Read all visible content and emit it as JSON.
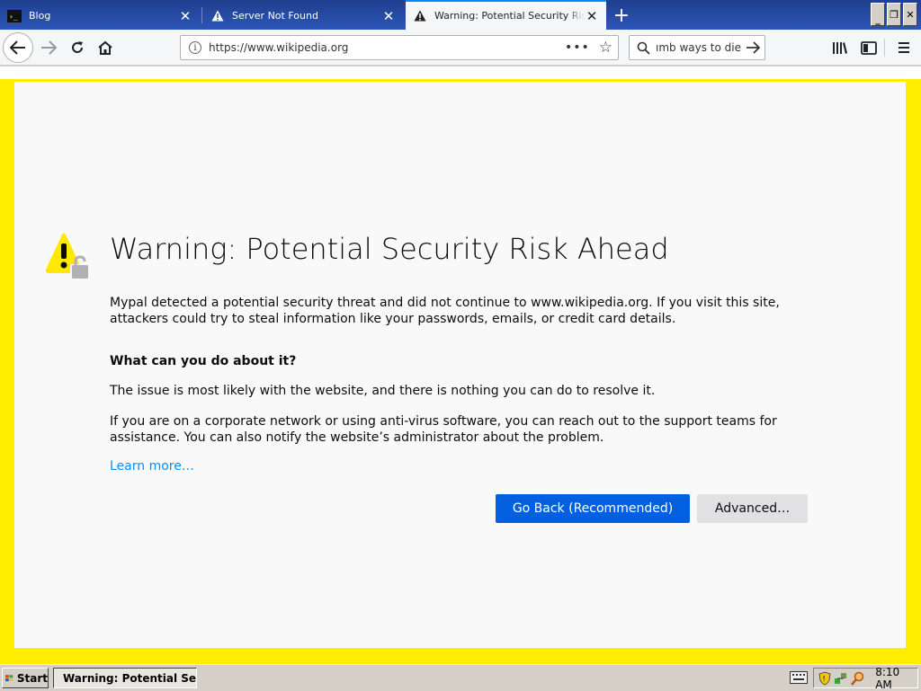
{
  "tabs": [
    {
      "label": "Blog",
      "icon": "terminal-icon"
    },
    {
      "label": "Server Not Found",
      "icon": "warning-icon"
    },
    {
      "label": "Warning: Potential Security Risk Ahead",
      "icon": "warning-icon",
      "active": true
    }
  ],
  "window_controls": {
    "minimize": "_",
    "restore": "❐",
    "close": "✕"
  },
  "nav": {
    "url": "https://www.wikipedia.org",
    "search_text": "ımb ways to die"
  },
  "page": {
    "title": "Warning: Potential Security Risk Ahead",
    "description": "Mypal detected a potential security threat and did not continue to www.wikipedia.org. If you visit this site, attackers could try to steal information like your passwords, emails, or credit card details.",
    "subheading": "What can you do about it?",
    "para1": "The issue is most likely with the website, and there is nothing you can do to resolve it.",
    "para2": "If you are on a corporate network or using anti-virus software, you can reach out to the support teams for assistance. You can also notify the website’s administrator about the problem.",
    "learn_more": "Learn more…",
    "go_back_label": "Go Back (Recommended)",
    "advanced_label": "Advanced…"
  },
  "taskbar": {
    "start_label": "Start",
    "task_label": "Warning: Potential Se...",
    "clock": "8:10 AM"
  },
  "colors": {
    "accent": "#0060df",
    "link": "#0a8dff",
    "border_highlight": "#ffee00",
    "warning": "#ffe900"
  }
}
